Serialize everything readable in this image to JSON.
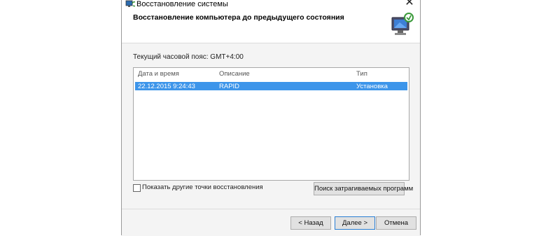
{
  "window": {
    "title": "Восстановление системы",
    "close_symbol": "✕"
  },
  "header": {
    "title": "Восстановление компьютера до предыдущего состояния",
    "icon": "monitor-restore-icon"
  },
  "content": {
    "timezone_label": "Текущий часовой пояс: GMT+4:00",
    "list": {
      "columns": [
        "Дата и время",
        "Описание",
        "Тип"
      ],
      "rows": [
        {
          "date": "22.12.2015 9:24:43",
          "description": "RAPID",
          "type": "Установка",
          "selected": true
        }
      ]
    },
    "show_more_label": "Показать другие точки восстановления",
    "show_more_checked": false,
    "scan_button": "Поиск затрагиваемых программ"
  },
  "footer": {
    "back_button": "< Назад",
    "next_button": "Далее >",
    "cancel_button": "Отмена"
  },
  "colors": {
    "selection": "#3d95ea",
    "button_face": "#e1e1e1",
    "default_button_border": "#2a7fd4"
  }
}
